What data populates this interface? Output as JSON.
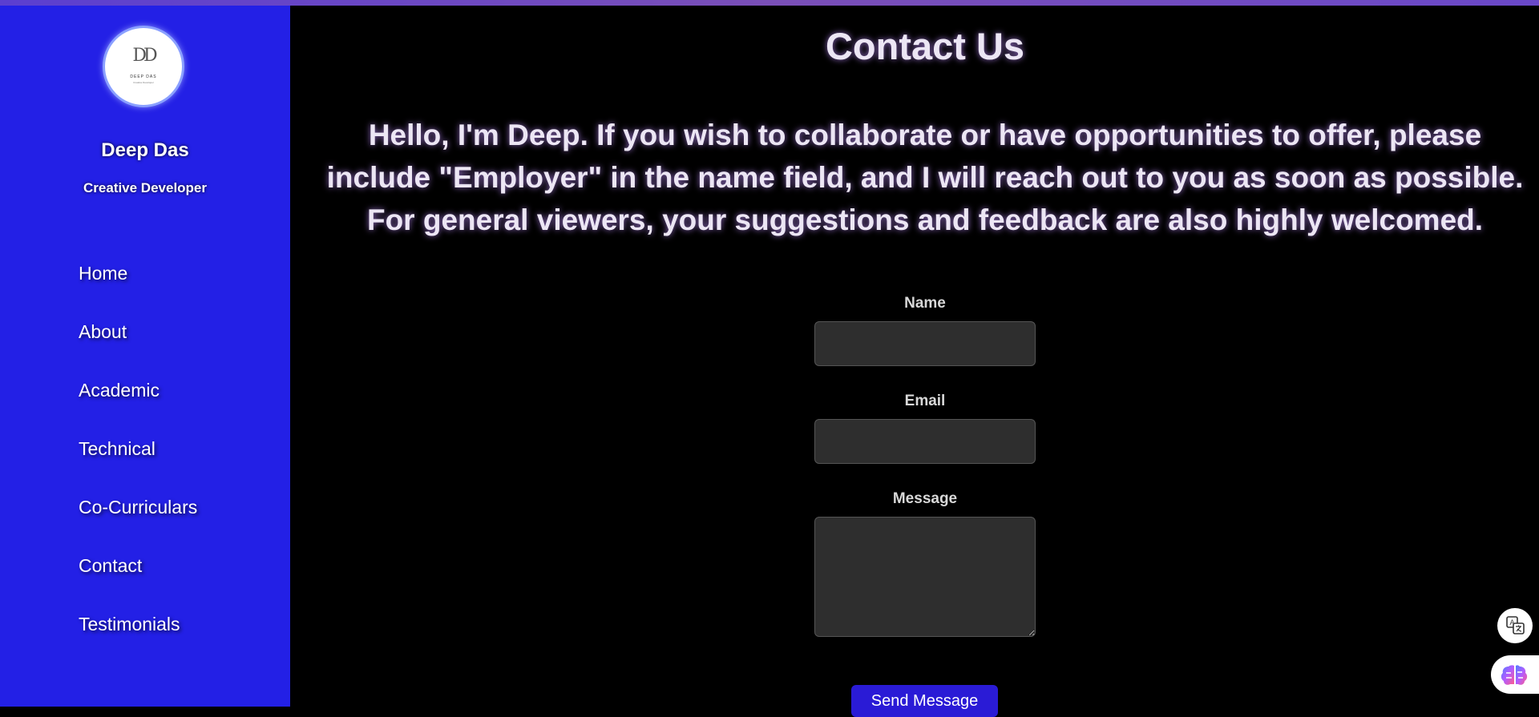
{
  "sidebar": {
    "logo": {
      "monogram": "DD",
      "brand": "DEEP DAS",
      "tagline": "Creative Developer"
    },
    "name": "Deep Das",
    "role": "Creative Developer",
    "nav": [
      {
        "label": "Home"
      },
      {
        "label": "About"
      },
      {
        "label": "Academic"
      },
      {
        "label": "Technical"
      },
      {
        "label": "Co-Curriculars"
      },
      {
        "label": "Contact"
      },
      {
        "label": "Testimonials"
      }
    ]
  },
  "main": {
    "title": "Contact Us",
    "intro": "Hello, I'm Deep. If you wish to collaborate or have opportunities to offer, please include \"Employer\" in the name field, and I will reach out to you as soon as possible. For general viewers, your suggestions and feedback are also highly welcomed.",
    "form": {
      "name_label": "Name",
      "name_value": "",
      "email_label": "Email",
      "email_value": "",
      "message_label": "Message",
      "message_value": "",
      "submit_label": "Send Message"
    }
  },
  "widgets": {
    "translate_icon": "translate-icon",
    "assistant_icon": "brain-icon"
  },
  "colors": {
    "sidebar_bg": "#2320e6",
    "page_bg": "#000000",
    "input_bg": "#2e2e2e",
    "button_bg": "#2a1bd6",
    "heading_text": "#ece6f4"
  }
}
